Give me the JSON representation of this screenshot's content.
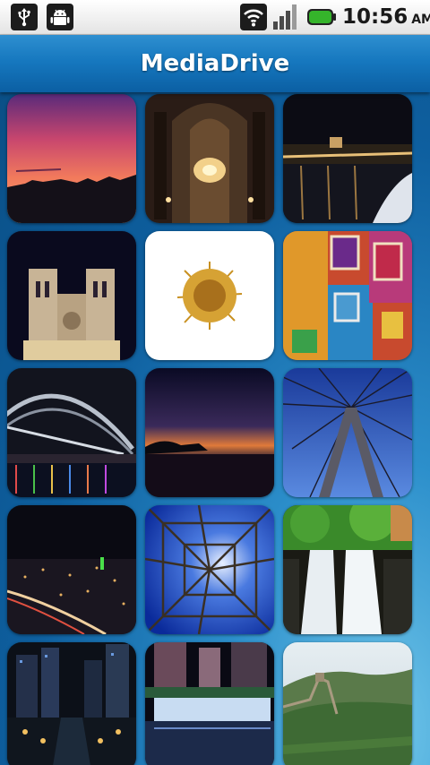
{
  "status_bar": {
    "time": "10:56",
    "ampm": "AM",
    "icons": [
      "usb-icon",
      "android-debug-icon",
      "wifi-icon",
      "signal-icon",
      "battery-icon"
    ],
    "battery_color": "#35b42b"
  },
  "app": {
    "title": "MediaDrive",
    "accent_color": "#1678bf"
  },
  "gallery": {
    "thumbnails": [
      "sunset-silhouette",
      "cathedral-interior",
      "river-night-city",
      "notre-dame-night",
      "golden-flower",
      "colorful-wall-windows",
      "harbour-bridge-night",
      "dusk-lake",
      "cable-bridge-pylon",
      "city-night-traffic",
      "tower-from-below",
      "waterfall-greenery",
      "city-canal-night",
      "fountain-night",
      "great-wall"
    ]
  }
}
